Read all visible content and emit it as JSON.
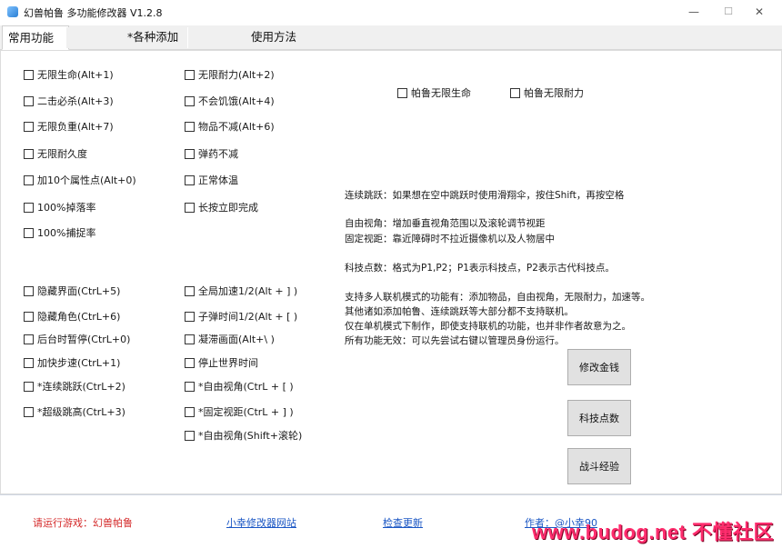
{
  "window": {
    "title": "幻兽帕鲁 多功能修改器  V1.2.8",
    "minimize": "—",
    "maximize": "☐",
    "close": "✕"
  },
  "tabs": [
    "常用功能",
    "*各种添加",
    "使用方法"
  ],
  "checkboxes": {
    "col1_top": [
      "无限生命(Alt+1)",
      "二击必杀(Alt+3)",
      "无限负重(Alt+7)",
      "无限耐久度",
      "加10个属性点(Alt+0)",
      "100%掉落率",
      "100%捕捉率"
    ],
    "col2_top": [
      "无限耐力(Alt+2)",
      "不会饥饿(Alt+4)",
      "物品不减(Alt+6)",
      "弹药不减",
      "正常体温",
      "长按立即完成"
    ],
    "col3_top": [
      "帕鲁无限生命",
      "帕鲁无限耐力"
    ],
    "col1_bottom": [
      "隐藏界面(CtrL+5)",
      "隐藏角色(CtrL+6)",
      "后台时暂停(CtrL+0)",
      "加快步速(CtrL+1)",
      "*连续跳跃(CtrL+2)",
      "*超级跳高(CtrL+3)"
    ],
    "col2_bottom": [
      "全局加速1/2(Alt + ] )",
      "子弹时间1/2(Alt + [ )",
      "凝滞画面(Alt+\\ )",
      "停止世界时间",
      "*自由视角(CtrL + [ )",
      "*固定视距(CtrL + ] )",
      "*自由视角(Shift+滚轮)"
    ]
  },
  "info": [
    "连续跳跃：如果想在空中跳跃时使用滑翔伞，按住Shift，再按空格",
    "自由视角：增加垂直视角范围以及滚轮调节视距",
    "固定视距：靠近障碍时不拉近摄像机以及人物居中",
    "科技点数：格式为P1,P2；P1表示科技点，P2表示古代科技点。",
    "支持多人联机模式的功能有：添加物品，自由视角，无限耐力，加速等。",
    "其他诸如添加帕鲁、连续跳跃等大部分都不支持联机。",
    "仅在单机模式下制作，即使支持联机的功能，也并非作者故意为之。",
    "所有功能无效：可以先尝试右键以管理员身份运行。"
  ],
  "buttons": [
    "修改金钱",
    "科技点数",
    "战斗经验"
  ],
  "footer": {
    "status": "请运行游戏：幻兽帕鲁",
    "site_link": "小幸修改器网站",
    "update_link": "检查更新",
    "author": "作者：@小幸90"
  },
  "watermark": "www.budog.net 不懂社区",
  "colors": {
    "status_red": "#d42a2a",
    "link_blue": "#1a56c4",
    "watermark_pink": "#ff2d6e"
  }
}
